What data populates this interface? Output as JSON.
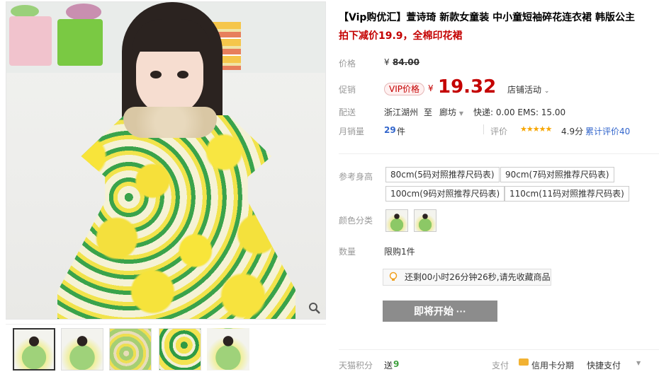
{
  "product": {
    "title": "【Vip购优汇】萱诗琦 新款女童装 中小童短袖碎花连衣裙 韩版公主",
    "subtitle": "拍下减价19.9，全棉印花裙"
  },
  "pricing": {
    "original_label": "价格",
    "original_currency": "¥",
    "original_price": "84.00",
    "promo_label": "促销",
    "vip_tag": "VIP价格",
    "promo_currency": "¥",
    "promo_price": "19.32",
    "store_activity": "店铺活动",
    "shipping_label": "配送",
    "shipping_from": "浙江湖州",
    "shipping_to_word": "至",
    "shipping_to": "廊坊",
    "shipping_cost": "快递: 0.00 EMS: 15.00",
    "monthly_sales_label": "月销量",
    "monthly_sales_value": "29",
    "monthly_sales_unit": "件",
    "rating_label": "评价",
    "rating_stars": "★★★★★",
    "rating_score": "4.9分",
    "total_reviews": "累计评价40"
  },
  "options": {
    "height_label": "参考身高",
    "sizes": [
      "80cm(5码对照推荐尺码表)",
      "90cm(7码对照推荐尺码表)",
      "100cm(9码对照推荐尺码表)",
      "110cm(11码对照推荐尺码表)"
    ],
    "color_label": "颜色分类",
    "quantity_label": "数量",
    "quantity_limit": "限购1件"
  },
  "countdown": {
    "text": "还剩00小时26分钟26秒,请先收藏商品"
  },
  "actions": {
    "start_button": "即将开始 ···"
  },
  "footer": {
    "points_label": "天猫积分",
    "points_prefix": "送",
    "points_value": "9",
    "pay_label": "支付",
    "credit_installment": "信用卡分期",
    "quick_pay": "快捷支付"
  },
  "colors": {
    "accent_red": "#c40000",
    "star_orange": "#f7a600",
    "link_blue": "#3366cc",
    "points_green": "#3c9f3c",
    "button_gray": "#8c8c8c"
  }
}
